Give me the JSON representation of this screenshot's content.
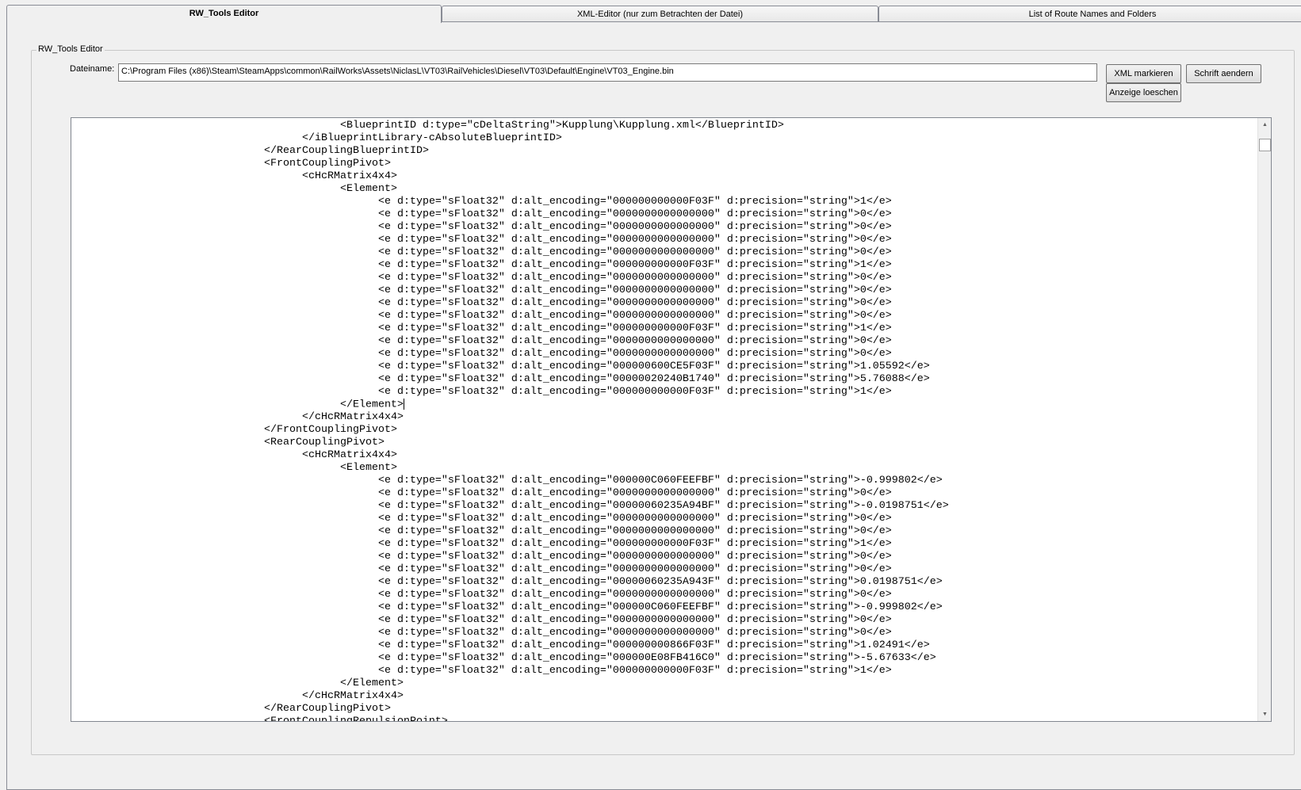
{
  "tabs": [
    {
      "label": "RW_Tools Editor",
      "active": true
    },
    {
      "label": "XML-Editor (nur zum Betrachten der Datei)",
      "active": false
    },
    {
      "label": "List of Route Names and Folders",
      "active": false
    }
  ],
  "group_title": "RW_Tools Editor",
  "filename": {
    "label": "Dateiname:",
    "value": "C:\\Program Files (x86)\\Steam\\SteamApps\\common\\RailWorks\\Assets\\NiclasL\\VT03\\RailVehicles\\Diesel\\VT03\\Default\\Engine\\VT03_Engine.bin"
  },
  "buttons": {
    "mark_xml": "XML markieren",
    "clear_display": "Anzeige loeschen",
    "change_font": "Schrift aendern"
  },
  "editor": {
    "caret_line": 22,
    "lines": [
      "\t\t\t\t<BlueprintID d:type=\"cDeltaString\">Kupplung\\Kupplung.xml</BlueprintID>",
      "\t\t\t</iBlueprintLibrary-cAbsoluteBlueprintID>",
      "\t\t</RearCouplingBlueprintID>",
      "\t\t<FrontCouplingPivot>",
      "\t\t\t<cHcRMatrix4x4>",
      "\t\t\t\t<Element>",
      "\t\t\t\t\t<e d:type=\"sFloat32\" d:alt_encoding=\"000000000000F03F\" d:precision=\"string\">1</e>",
      "\t\t\t\t\t<e d:type=\"sFloat32\" d:alt_encoding=\"0000000000000000\" d:precision=\"string\">0</e>",
      "\t\t\t\t\t<e d:type=\"sFloat32\" d:alt_encoding=\"0000000000000000\" d:precision=\"string\">0</e>",
      "\t\t\t\t\t<e d:type=\"sFloat32\" d:alt_encoding=\"0000000000000000\" d:precision=\"string\">0</e>",
      "\t\t\t\t\t<e d:type=\"sFloat32\" d:alt_encoding=\"0000000000000000\" d:precision=\"string\">0</e>",
      "\t\t\t\t\t<e d:type=\"sFloat32\" d:alt_encoding=\"000000000000F03F\" d:precision=\"string\">1</e>",
      "\t\t\t\t\t<e d:type=\"sFloat32\" d:alt_encoding=\"0000000000000000\" d:precision=\"string\">0</e>",
      "\t\t\t\t\t<e d:type=\"sFloat32\" d:alt_encoding=\"0000000000000000\" d:precision=\"string\">0</e>",
      "\t\t\t\t\t<e d:type=\"sFloat32\" d:alt_encoding=\"0000000000000000\" d:precision=\"string\">0</e>",
      "\t\t\t\t\t<e d:type=\"sFloat32\" d:alt_encoding=\"0000000000000000\" d:precision=\"string\">0</e>",
      "\t\t\t\t\t<e d:type=\"sFloat32\" d:alt_encoding=\"000000000000F03F\" d:precision=\"string\">1</e>",
      "\t\t\t\t\t<e d:type=\"sFloat32\" d:alt_encoding=\"0000000000000000\" d:precision=\"string\">0</e>",
      "\t\t\t\t\t<e d:type=\"sFloat32\" d:alt_encoding=\"0000000000000000\" d:precision=\"string\">0</e>",
      "\t\t\t\t\t<e d:type=\"sFloat32\" d:alt_encoding=\"000000600CE5F03F\" d:precision=\"string\">1.05592</e>",
      "\t\t\t\t\t<e d:type=\"sFloat32\" d:alt_encoding=\"00000020240B1740\" d:precision=\"string\">5.76088</e>",
      "\t\t\t\t\t<e d:type=\"sFloat32\" d:alt_encoding=\"000000000000F03F\" d:precision=\"string\">1</e>",
      "\t\t\t\t</Element>",
      "\t\t\t</cHcRMatrix4x4>",
      "\t\t</FrontCouplingPivot>",
      "\t\t<RearCouplingPivot>",
      "\t\t\t<cHcRMatrix4x4>",
      "\t\t\t\t<Element>",
      "\t\t\t\t\t<e d:type=\"sFloat32\" d:alt_encoding=\"000000C060FEEFBF\" d:precision=\"string\">-0.999802</e>",
      "\t\t\t\t\t<e d:type=\"sFloat32\" d:alt_encoding=\"0000000000000000\" d:precision=\"string\">0</e>",
      "\t\t\t\t\t<e d:type=\"sFloat32\" d:alt_encoding=\"00000060235A94BF\" d:precision=\"string\">-0.0198751</e>",
      "\t\t\t\t\t<e d:type=\"sFloat32\" d:alt_encoding=\"0000000000000000\" d:precision=\"string\">0</e>",
      "\t\t\t\t\t<e d:type=\"sFloat32\" d:alt_encoding=\"0000000000000000\" d:precision=\"string\">0</e>",
      "\t\t\t\t\t<e d:type=\"sFloat32\" d:alt_encoding=\"000000000000F03F\" d:precision=\"string\">1</e>",
      "\t\t\t\t\t<e d:type=\"sFloat32\" d:alt_encoding=\"0000000000000000\" d:precision=\"string\">0</e>",
      "\t\t\t\t\t<e d:type=\"sFloat32\" d:alt_encoding=\"0000000000000000\" d:precision=\"string\">0</e>",
      "\t\t\t\t\t<e d:type=\"sFloat32\" d:alt_encoding=\"00000060235A943F\" d:precision=\"string\">0.0198751</e>",
      "\t\t\t\t\t<e d:type=\"sFloat32\" d:alt_encoding=\"0000000000000000\" d:precision=\"string\">0</e>",
      "\t\t\t\t\t<e d:type=\"sFloat32\" d:alt_encoding=\"000000C060FEEFBF\" d:precision=\"string\">-0.999802</e>",
      "\t\t\t\t\t<e d:type=\"sFloat32\" d:alt_encoding=\"0000000000000000\" d:precision=\"string\">0</e>",
      "\t\t\t\t\t<e d:type=\"sFloat32\" d:alt_encoding=\"0000000000000000\" d:precision=\"string\">0</e>",
      "\t\t\t\t\t<e d:type=\"sFloat32\" d:alt_encoding=\"000000000866F03F\" d:precision=\"string\">1.02491</e>",
      "\t\t\t\t\t<e d:type=\"sFloat32\" d:alt_encoding=\"000000E08FB416C0\" d:precision=\"string\">-5.67633</e>",
      "\t\t\t\t\t<e d:type=\"sFloat32\" d:alt_encoding=\"000000000000F03F\" d:precision=\"string\">1</e>",
      "\t\t\t\t</Element>",
      "\t\t\t</cHcRMatrix4x4>",
      "\t\t</RearCouplingPivot>",
      "\t\t<FrontCouplingRepulsionPoint>"
    ]
  }
}
